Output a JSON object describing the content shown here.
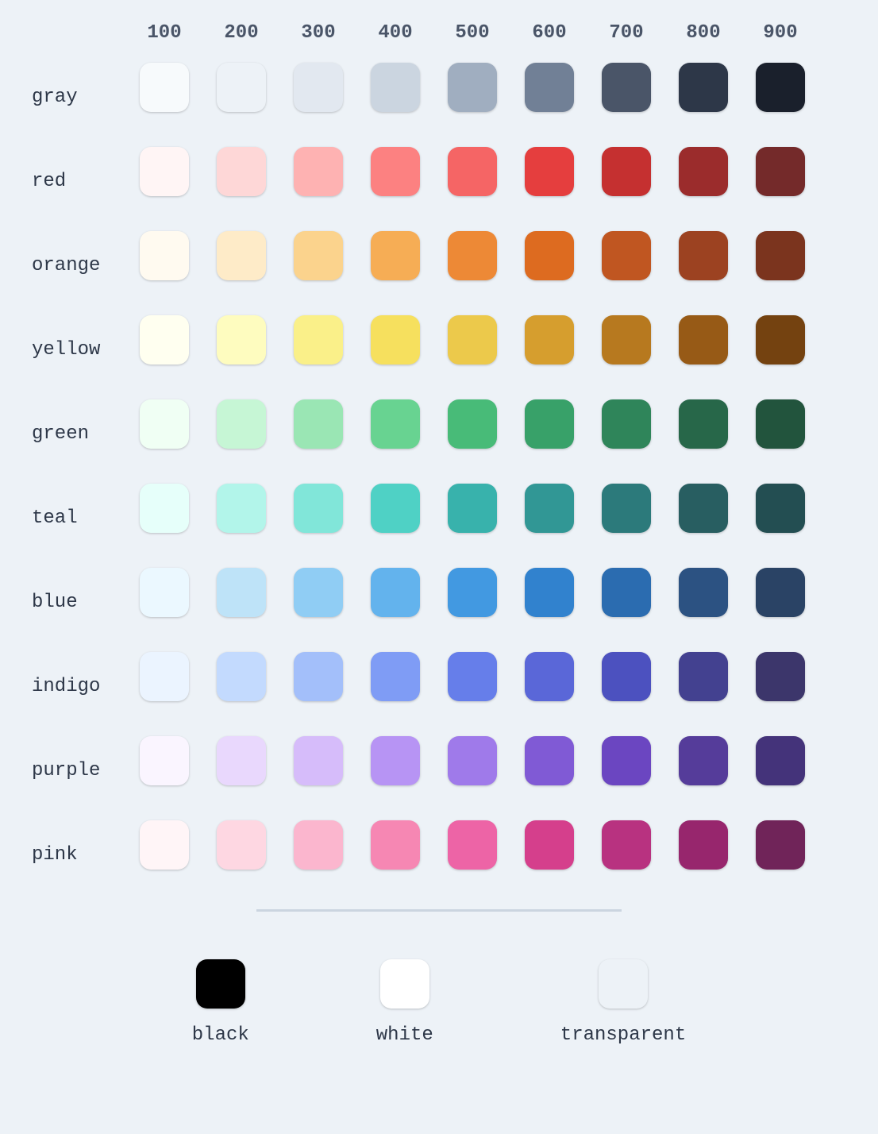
{
  "shades": [
    "100",
    "200",
    "300",
    "400",
    "500",
    "600",
    "700",
    "800",
    "900"
  ],
  "rows": [
    {
      "name": "gray",
      "colors": [
        "#f7fafc",
        "#edf2f7",
        "#e2e8f0",
        "#cbd5e0",
        "#a0aec0",
        "#718096",
        "#4a5568",
        "#2d3748",
        "#1a202c"
      ]
    },
    {
      "name": "red",
      "colors": [
        "#fff5f5",
        "#fed7d7",
        "#feb2b2",
        "#fc8181",
        "#f56565",
        "#e53e3e",
        "#c53030",
        "#9b2c2c",
        "#742a2a"
      ]
    },
    {
      "name": "orange",
      "colors": [
        "#fffaf0",
        "#feebc8",
        "#fbd38d",
        "#f6ad55",
        "#ed8936",
        "#dd6b20",
        "#c05621",
        "#9c4221",
        "#7b341e"
      ]
    },
    {
      "name": "yellow",
      "colors": [
        "#fffff0",
        "#fefcbf",
        "#faf089",
        "#f6e05e",
        "#ecc94b",
        "#d69e2e",
        "#b7791f",
        "#975a16",
        "#744210"
      ]
    },
    {
      "name": "green",
      "colors": [
        "#f0fff4",
        "#c6f6d5",
        "#9ae6b4",
        "#68d391",
        "#48bb78",
        "#38a169",
        "#2f855a",
        "#276749",
        "#22543d"
      ]
    },
    {
      "name": "teal",
      "colors": [
        "#e6fffa",
        "#b2f5ea",
        "#81e6d9",
        "#4fd1c5",
        "#38b2ac",
        "#319795",
        "#2c7a7b",
        "#285e61",
        "#234e52"
      ]
    },
    {
      "name": "blue",
      "colors": [
        "#ebf8ff",
        "#bee3f8",
        "#90cdf4",
        "#63b3ed",
        "#4299e1",
        "#3182ce",
        "#2b6cb0",
        "#2c5282",
        "#2a4365"
      ]
    },
    {
      "name": "indigo",
      "colors": [
        "#ebf4ff",
        "#c3dafe",
        "#a3bffa",
        "#7f9cf5",
        "#667eea",
        "#5a67d8",
        "#4c51bf",
        "#434190",
        "#3c366b"
      ]
    },
    {
      "name": "purple",
      "colors": [
        "#faf5ff",
        "#e9d8fd",
        "#d6bcfa",
        "#b794f4",
        "#9f7aea",
        "#805ad5",
        "#6b46c1",
        "#553c9a",
        "#44337a"
      ]
    },
    {
      "name": "pink",
      "colors": [
        "#fff5f7",
        "#fed7e2",
        "#fbb6ce",
        "#f687b3",
        "#ed64a6",
        "#d53f8c",
        "#b83280",
        "#97266d",
        "#702459"
      ]
    }
  ],
  "extras": [
    {
      "name": "black",
      "color": "#000000"
    },
    {
      "name": "white",
      "color": "#ffffff"
    },
    {
      "name": "transparent",
      "color": "transparent",
      "fallback": "#edf2f7"
    }
  ]
}
